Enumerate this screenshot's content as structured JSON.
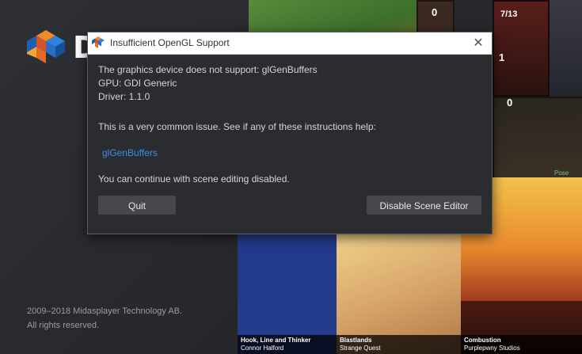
{
  "splash": {
    "logo_letter": "D",
    "copyright_line1": "2009–2018 Midasplayer Technology AB.",
    "copyright_line2": "All rights reserved."
  },
  "collage": {
    "cards": [
      {
        "num": "0"
      },
      {
        "num": "7/13"
      },
      {
        "num": "1"
      },
      {
        "num": "0"
      }
    ],
    "games": [
      {
        "title": "Hook, Line and Thinker",
        "author": "Connor Halford"
      },
      {
        "title": "Blastlands",
        "author": "Strange Quest"
      },
      {
        "title": "Combustion",
        "author": "Purplepwny Studios"
      }
    ],
    "partial_label": "Pose"
  },
  "dialog": {
    "title": "Insufficient OpenGL Support",
    "close_glyph": "✕",
    "line1": "The graphics device does not support: glGenBuffers",
    "line2": "GPU: GDI Generic",
    "line3": "Driver: 1.1.0",
    "line4": "This is a very common issue. See if any of these instructions help:",
    "link": "glGenBuffers",
    "line5": "You can continue with scene editing disabled.",
    "quit_label": "Quit",
    "disable_label": "Disable Scene Editor"
  },
  "colors": {
    "accent_link": "#3b8fe6",
    "dialog_bg": "#2b2c30",
    "button_bg": "#46474c"
  },
  "icons": [
    "defold-logo-icon",
    "app-icon",
    "close-icon"
  ]
}
